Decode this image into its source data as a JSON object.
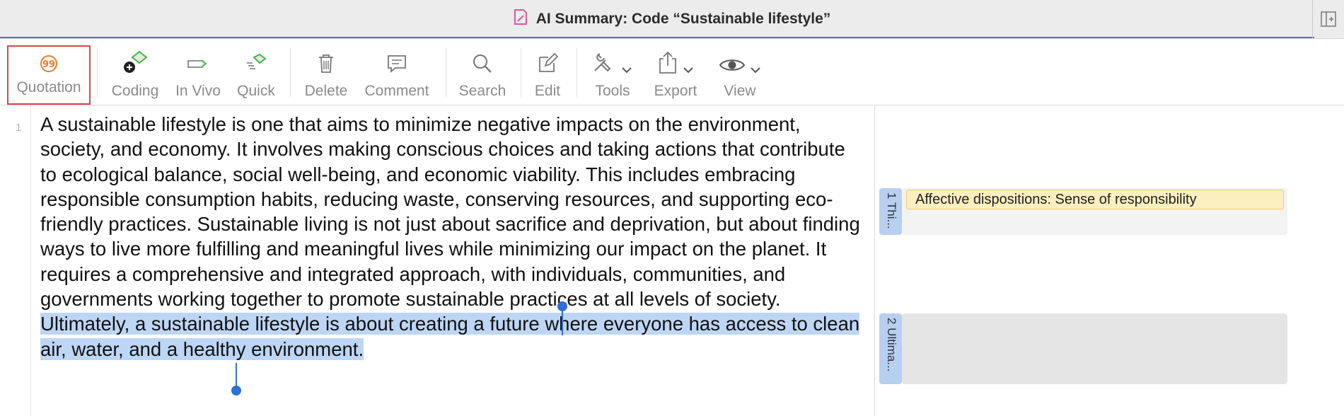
{
  "window": {
    "title": "AI Summary: Code “Sustainable lifestyle”"
  },
  "toolbar": {
    "items": [
      {
        "label": "Quotation",
        "icon": "quotation-icon",
        "selected": true
      },
      {
        "label": "Coding",
        "icon": "coding-icon"
      },
      {
        "label": "In Vivo",
        "icon": "in-vivo-icon"
      },
      {
        "label": "Quick",
        "icon": "quick-coding-icon"
      },
      {
        "label": "Delete",
        "icon": "trash-icon"
      },
      {
        "label": "Comment",
        "icon": "comment-icon"
      },
      {
        "label": "Search",
        "icon": "search-icon"
      },
      {
        "label": "Edit",
        "icon": "edit-icon"
      },
      {
        "label": "Tools",
        "icon": "tools-icon"
      },
      {
        "label": "Export",
        "icon": "share-icon"
      },
      {
        "label": "View",
        "icon": "eye-icon"
      }
    ]
  },
  "document": {
    "line_number": "1",
    "paragraph_plain": "A sustainable lifestyle is one that aims to minimize negative impacts on the environment, society, and economy. It involves making conscious choices and taking actions that contribute to ecological balance, social well-being, and economic viability. This includes embracing responsible consumption habits, reducing waste, conserving resources, and supporting eco-friendly practices. Sustainable living is not just about sacrifice and deprivation, but about finding ways to live more fulfilling and meaningful lives while minimizing our impact on the planet. It requires a comprehensive and integrated approach, with individuals, communities, and governments working together to promote sustainable practices at all levels of society. ",
    "paragraph_selected": "Ultimately, a sustainable lifestyle is about creating a future where everyone has access to clean air, water, and a healthy environment."
  },
  "margin": {
    "quotations": [
      {
        "tab_label": "1 Thi...",
        "codes": [
          "Affective dispositions: Sense of responsibility"
        ]
      },
      {
        "tab_label": "2 Ultima...",
        "codes": []
      }
    ]
  },
  "colors": {
    "selection": "#bdd6f5",
    "quotation_tab": "#b7cff0",
    "code_tag_fill": "#fbefbf",
    "code_tag_border": "#e7cc6e",
    "selected_tool_border": "#e04545",
    "accent": "#3a7be0",
    "doc_icon": "#e0559b",
    "quotation_icon": "#f07a2a",
    "coding_icon": "#4caf50"
  }
}
